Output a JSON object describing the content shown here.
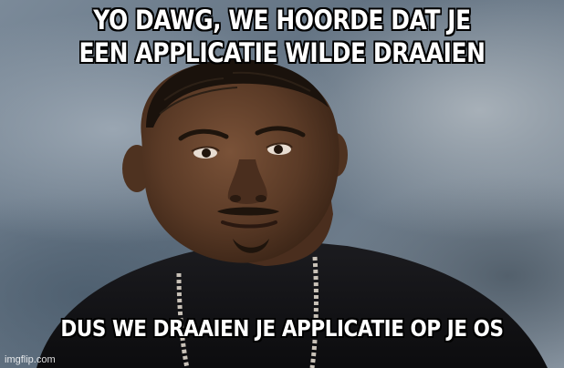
{
  "meme": {
    "top_text_line1": "YO DAWG, WE HOORDE DAT JE",
    "top_text_line2": "EEN APPLICATIE WILDE DRAAIEN",
    "bottom_text": "DUS WE DRAAIEN JE APPLICATIE OP JE OS",
    "watermark": "imgflip.com"
  },
  "colors": {
    "text": "#ffffff",
    "text_outline": "#000000",
    "background": "#6f7d8c",
    "skin": "#5a3a26",
    "shirt": "#141416"
  }
}
